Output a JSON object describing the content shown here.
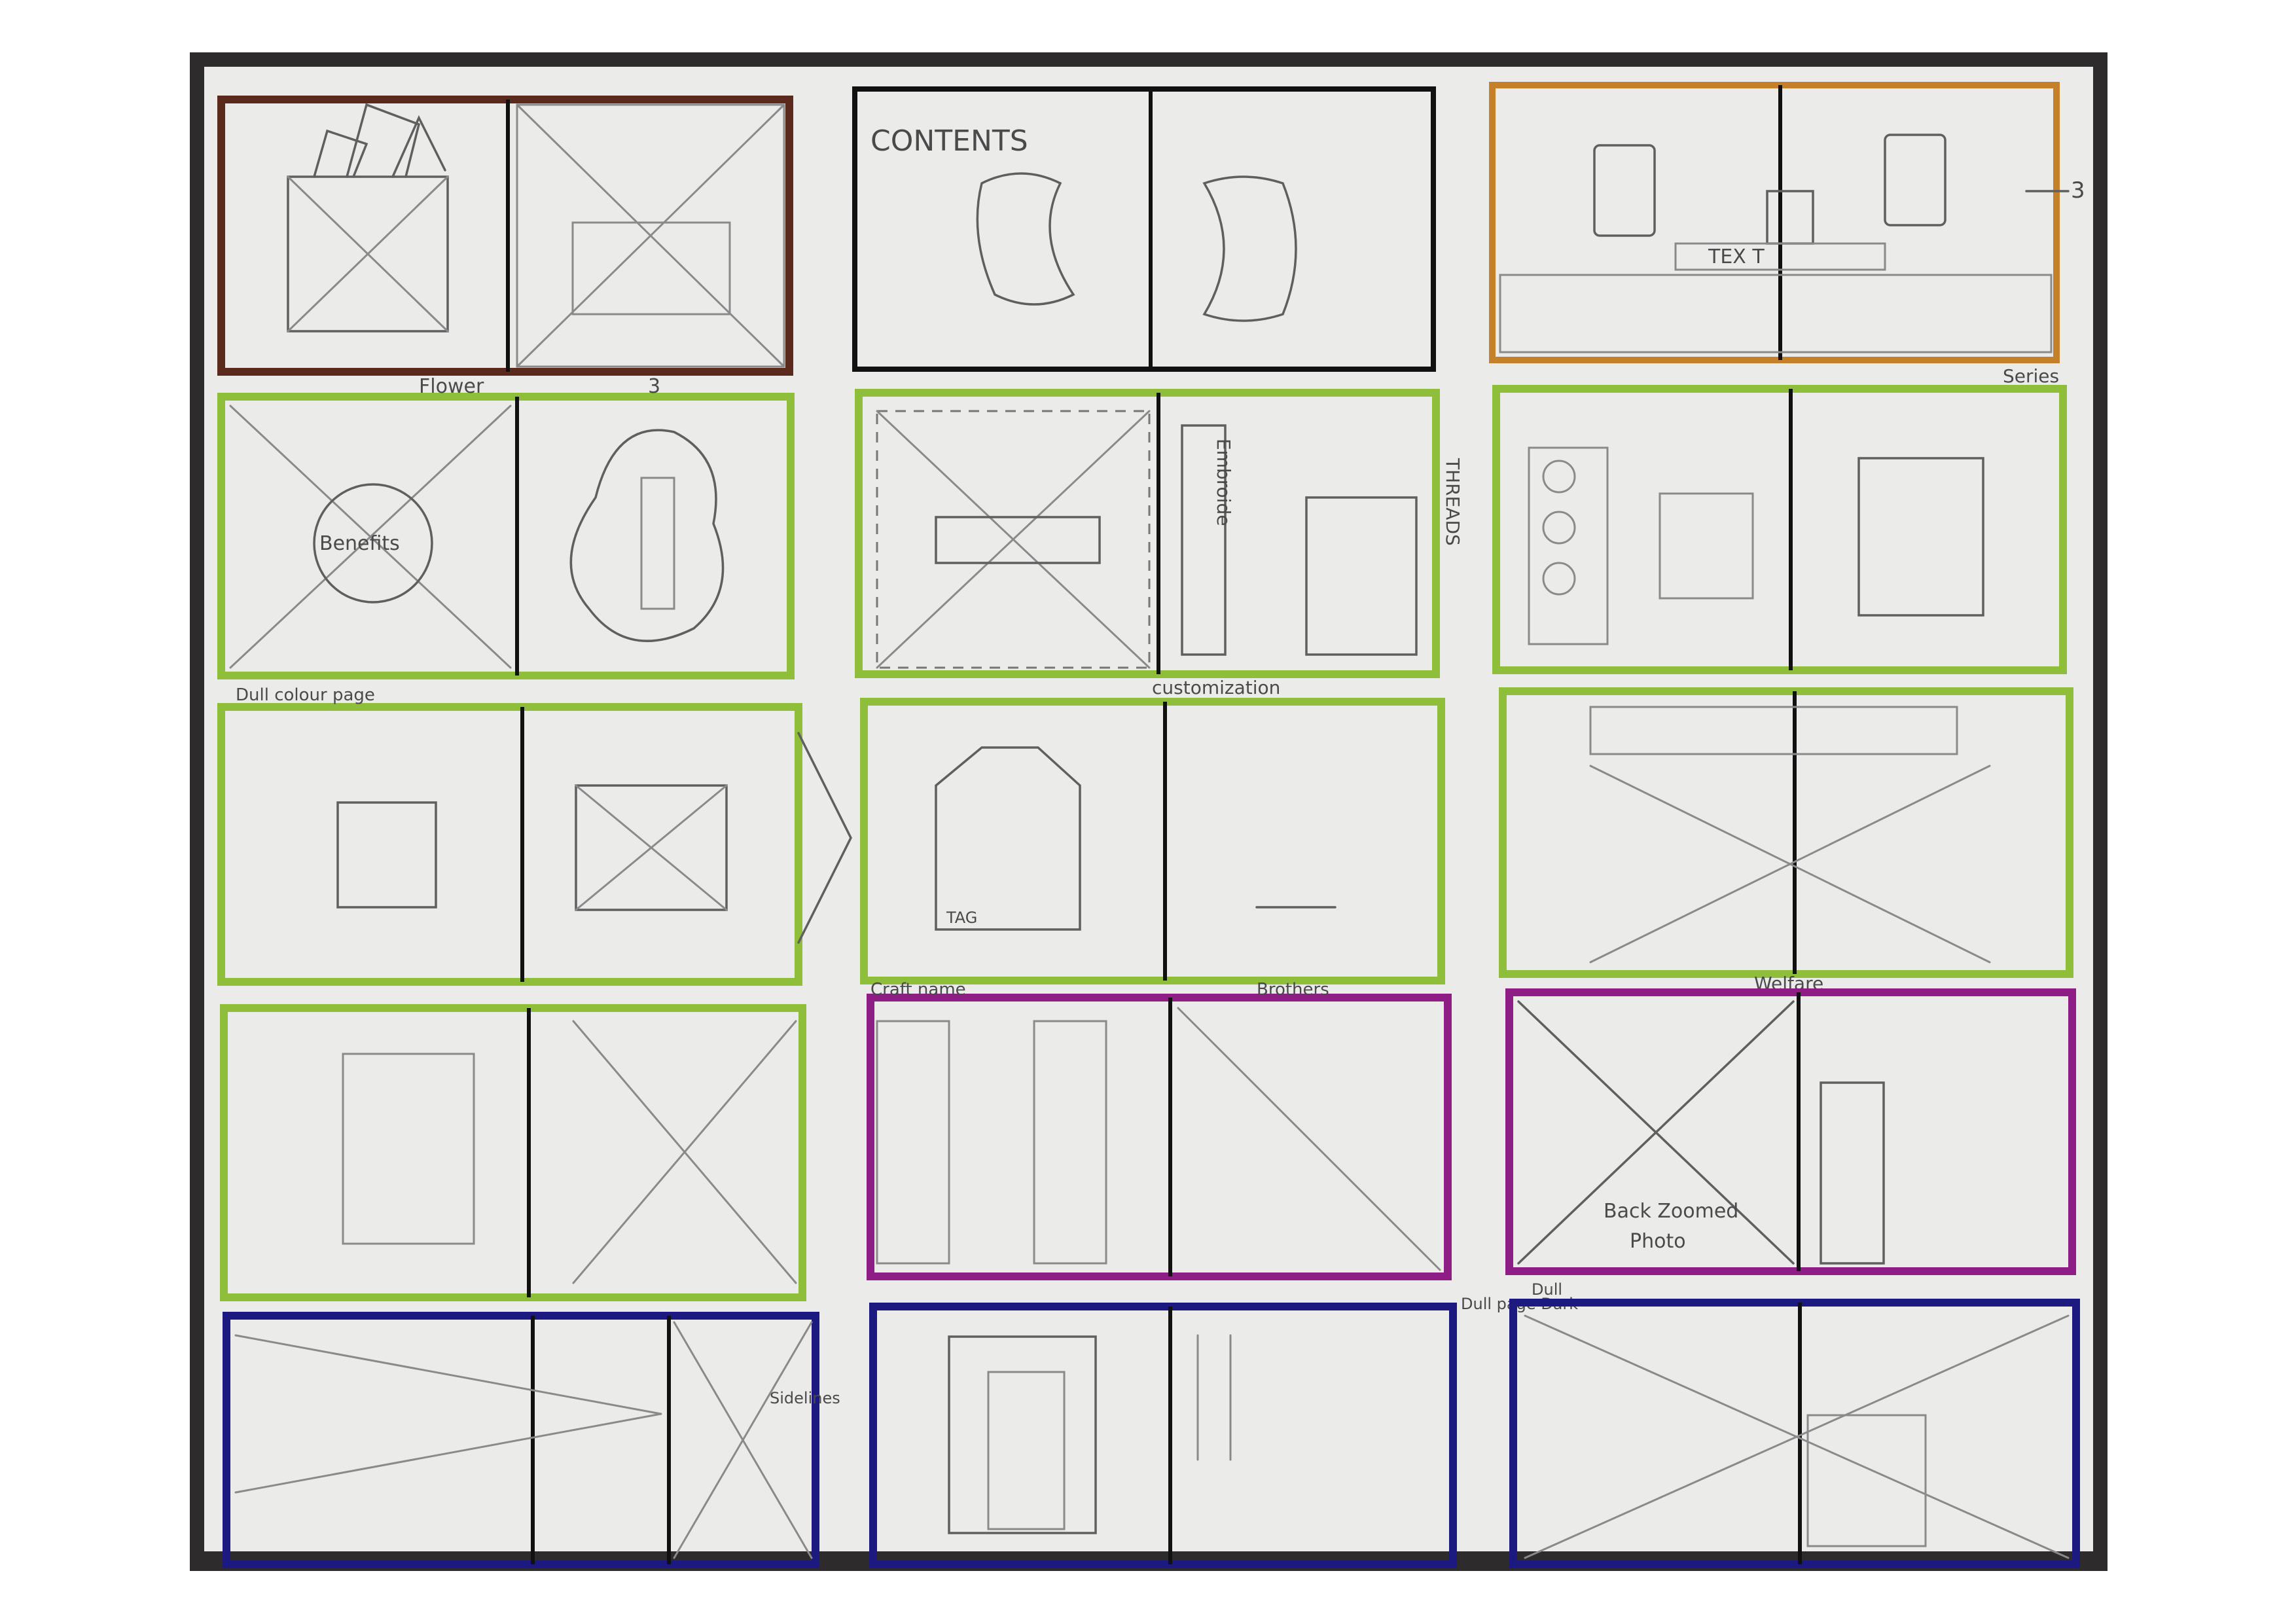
{
  "colors": {
    "frame": "#2d2b2c",
    "paper": "#ebebea",
    "ink": "#111111",
    "pencil": "#8a8a8a",
    "brown": "#5a2b1c",
    "orange": "#c7802a",
    "green": "#8fbe3a",
    "purple": "#8e1e86",
    "navy": "#1c1a80"
  },
  "labels": {
    "contents": "CONTENTS",
    "text": "TEX T",
    "ref_three_a": "3",
    "ref_three_b": "3",
    "flower": "Flower",
    "benefits": "Benefits",
    "embroidery": "Embroide",
    "threads": "THREADS",
    "dull_colour": "Dull colour page",
    "customization": "customization",
    "tag": "TAG",
    "craft_name": "Craft name",
    "brothers": "Brothers",
    "welfare": "Welfare",
    "back_zoomed": "Back Zoomed",
    "photo": "Photo",
    "sidelines": "Sidelines",
    "dull_page_dark": "Dull page Dark",
    "dull_bottom": "Dull",
    "series": "Series"
  }
}
